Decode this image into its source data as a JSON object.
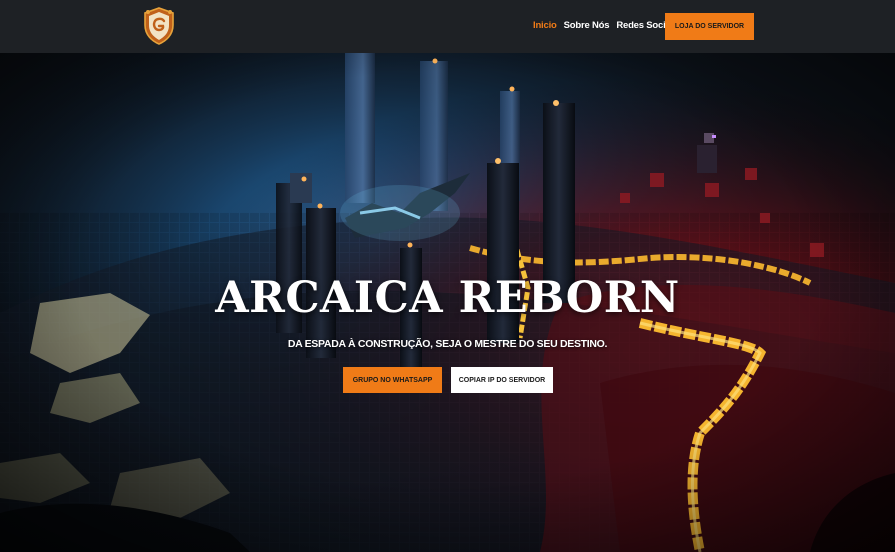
{
  "header": {
    "logo_icon": "shield-emblem-icon",
    "nav": [
      {
        "label": "Inicio",
        "active": true
      },
      {
        "label": "Sobre Nós",
        "active": false
      },
      {
        "label": "Redes Sociais",
        "active": false
      }
    ],
    "store_button": "LOJA DO SERVIDOR"
  },
  "hero": {
    "title": "ARCAICA REBORN",
    "subtitle": "DA ESPADA À CONSTRUÇÃO, SEJA O MESTRE DO SEU DESTINO.",
    "whatsapp_button": "GRUPO NO WHATSAPP",
    "copy_ip_button": "COPIAR IP DO SERVIDOR"
  },
  "colors": {
    "accent": "#f07b17",
    "header_bg": "#1e2125",
    "text": "#ffffff"
  }
}
